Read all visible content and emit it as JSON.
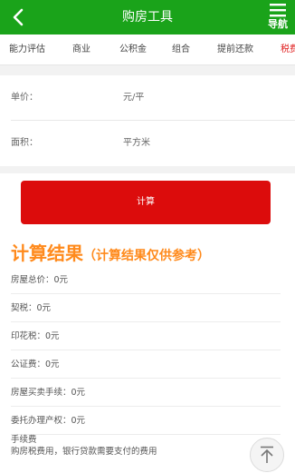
{
  "header": {
    "title": "购房工具",
    "nav_label": "导航",
    "bg_color": "#1aa31a"
  },
  "tabs": [
    {
      "label": "能力评估"
    },
    {
      "label": "商业"
    },
    {
      "label": "公积金"
    },
    {
      "label": "组合"
    },
    {
      "label": "提前还款"
    },
    {
      "label": "税费"
    }
  ],
  "form": {
    "unit_price": {
      "label": "单价：",
      "unit": "元/平"
    },
    "area": {
      "label": "面积：",
      "unit": "平方米"
    }
  },
  "calc_button": {
    "label": "计算",
    "color": "#dc0c0c"
  },
  "results": {
    "title": "计算结果",
    "title_note": "（计算结果仅供参考）",
    "title_color": "#ff8a1c",
    "items": [
      {
        "text": "房屋总价：0元"
      },
      {
        "text": "契税：0元"
      },
      {
        "text": "印花税：0元"
      },
      {
        "text": "公证费：0元"
      },
      {
        "text": "房屋买卖手续：0元"
      },
      {
        "text": "委托办理产权：0元"
      }
    ],
    "fee": {
      "label": "手续费",
      "desc": "购房税费用，银行贷款需要支付的费用"
    }
  },
  "icons": {
    "back": "chevron-left-icon",
    "menu": "hamburger-menu-icon",
    "top": "arrow-up-icon"
  }
}
